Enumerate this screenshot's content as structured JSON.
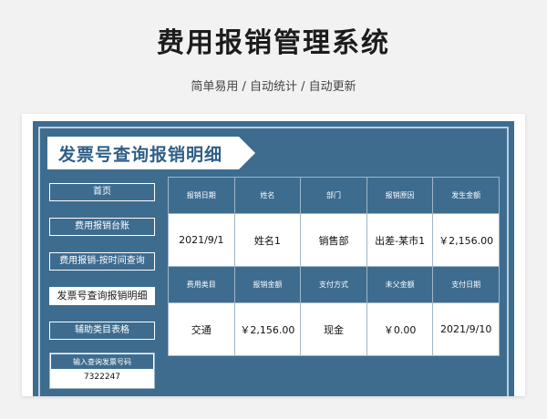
{
  "page": {
    "title": "费用报销管理系统",
    "subtitle": "简单易用 / 自动统计 / 自动更新"
  },
  "sheet": {
    "banner_title": "发票号查询报销明细",
    "nav": [
      {
        "label": "首页"
      },
      {
        "label": "费用报销台账"
      },
      {
        "label": "费用报销-按时间查询"
      },
      {
        "label": "发票号查询报销明细"
      },
      {
        "label": "辅助类目表格"
      }
    ],
    "search": {
      "label": "输入查询发票号码",
      "value": "7322247"
    },
    "table": {
      "row1_headers": [
        "报销日期",
        "姓名",
        "部门",
        "报销原因",
        "发生金额"
      ],
      "row1_values": [
        "2021/9/1",
        "姓名1",
        "销售部",
        "出差-某市1",
        "￥2,156.00"
      ],
      "row2_headers": [
        "费用类目",
        "报销金额",
        "支付方式",
        "未父金额",
        "支付日期"
      ],
      "row2_values": [
        "交通",
        "￥2,156.00",
        "现金",
        "￥0.00",
        "2021/9/10"
      ]
    },
    "colors": {
      "sheet_blue": "#3e6c8f",
      "frame_light": "#b9cfdf",
      "banner_text": "#2f5f86"
    }
  }
}
